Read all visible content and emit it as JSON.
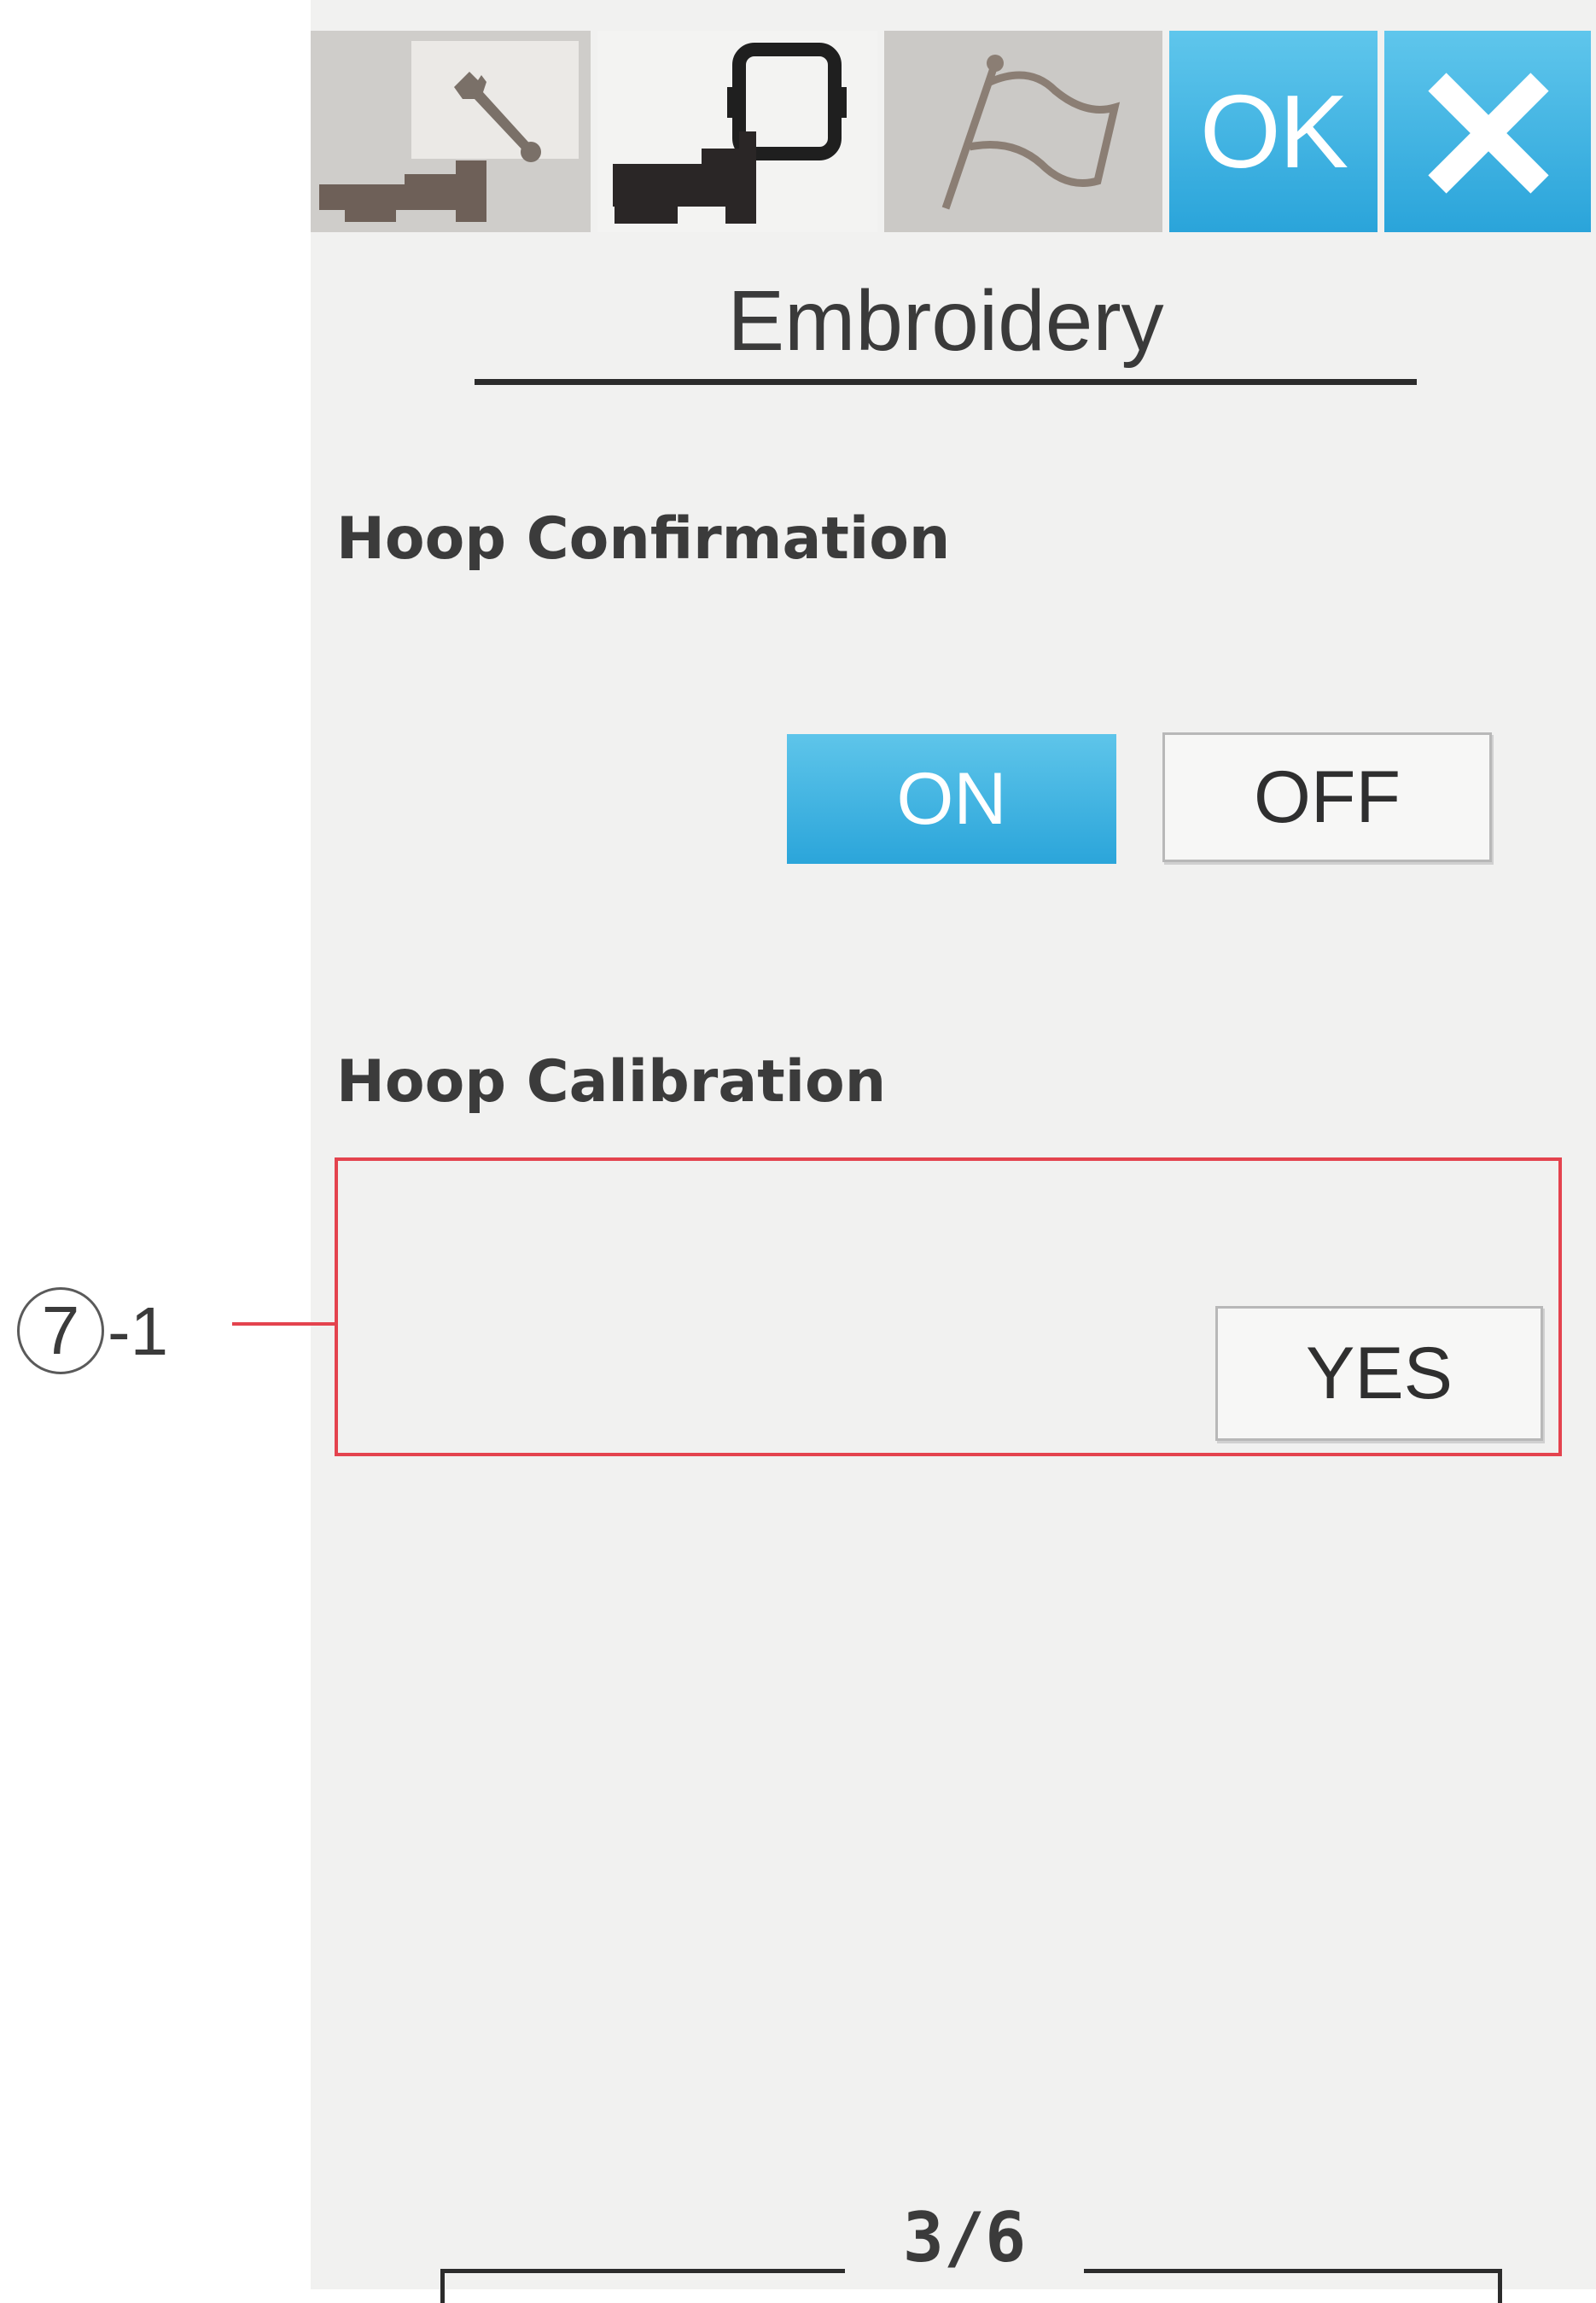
{
  "toolbar": {
    "tabs": [
      {
        "name": "machine-settings",
        "icon": "wrench-machine-icon",
        "active": false
      },
      {
        "name": "embroidery-settings",
        "icon": "machine-hoop-icon",
        "active": true
      },
      {
        "name": "language",
        "icon": "flag-icon",
        "active": false
      }
    ],
    "ok_label": "OK",
    "close_icon": "close-icon"
  },
  "page": {
    "title": "Embroidery",
    "indicator": "3/6"
  },
  "hoop_confirmation": {
    "label": "Hoop Confirmation",
    "on_label": "ON",
    "off_label": "OFF",
    "selected": "ON"
  },
  "hoop_calibration": {
    "label": "Hoop Calibration",
    "yes_label": "YES"
  },
  "callout": {
    "number": "7",
    "suffix": "-1"
  },
  "colors": {
    "accent_blue": "#2aa4da",
    "highlight_red": "#e4434e",
    "panel_bg": "#f1f1f0"
  }
}
